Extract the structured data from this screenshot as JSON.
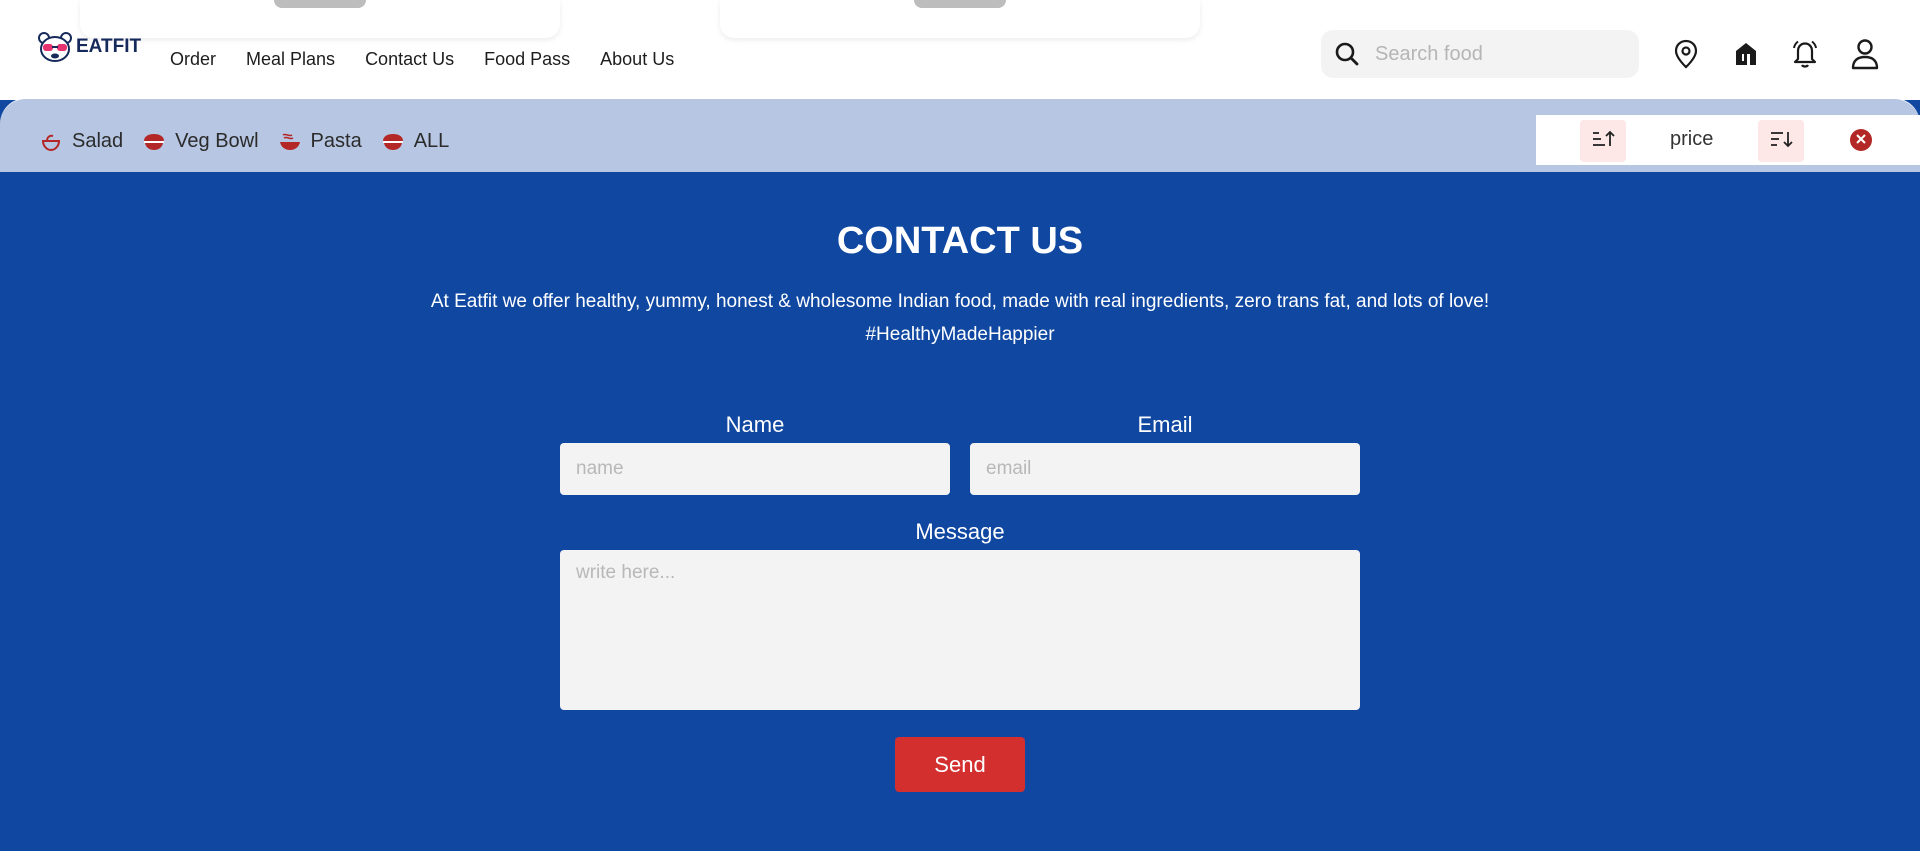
{
  "brand": {
    "name": "EATFIT"
  },
  "nav": [
    {
      "label": "Order"
    },
    {
      "label": "Meal Plans"
    },
    {
      "label": "Contact Us"
    },
    {
      "label": "Food Pass"
    },
    {
      "label": "About Us"
    }
  ],
  "search": {
    "placeholder": "Search food",
    "icon": "search-icon"
  },
  "header_icons": [
    "location-pin-icon",
    "store-icon",
    "bell-icon",
    "user-icon"
  ],
  "categories": [
    {
      "label": "Salad",
      "icon": "salad-bowl-icon"
    },
    {
      "label": "Veg Bowl",
      "icon": "bowl-icon"
    },
    {
      "label": "Pasta",
      "icon": "pasta-icon"
    },
    {
      "label": "ALL",
      "icon": "bowl-icon"
    }
  ],
  "sort": {
    "label": "price",
    "asc_icon": "sort-ascending-icon",
    "desc_icon": "sort-descending-icon",
    "clear_icon": "close-circle-icon"
  },
  "contact": {
    "title": "CONTACT US",
    "description": "At Eatfit we offer healthy, yummy, honest & wholesome Indian food, made with real ingredients, zero trans fat, and lots of love! #HealthyMadeHappier",
    "name_label": "Name",
    "name_placeholder": "name",
    "email_label": "Email",
    "email_placeholder": "email",
    "message_label": "Message",
    "message_placeholder": "write here...",
    "send_label": "Send"
  },
  "colors": {
    "primary_blue": "#0f47a1",
    "category_bar": "#b7c6e2",
    "accent_red": "#d32f2f",
    "sort_button_bg": "#fde7e7"
  }
}
